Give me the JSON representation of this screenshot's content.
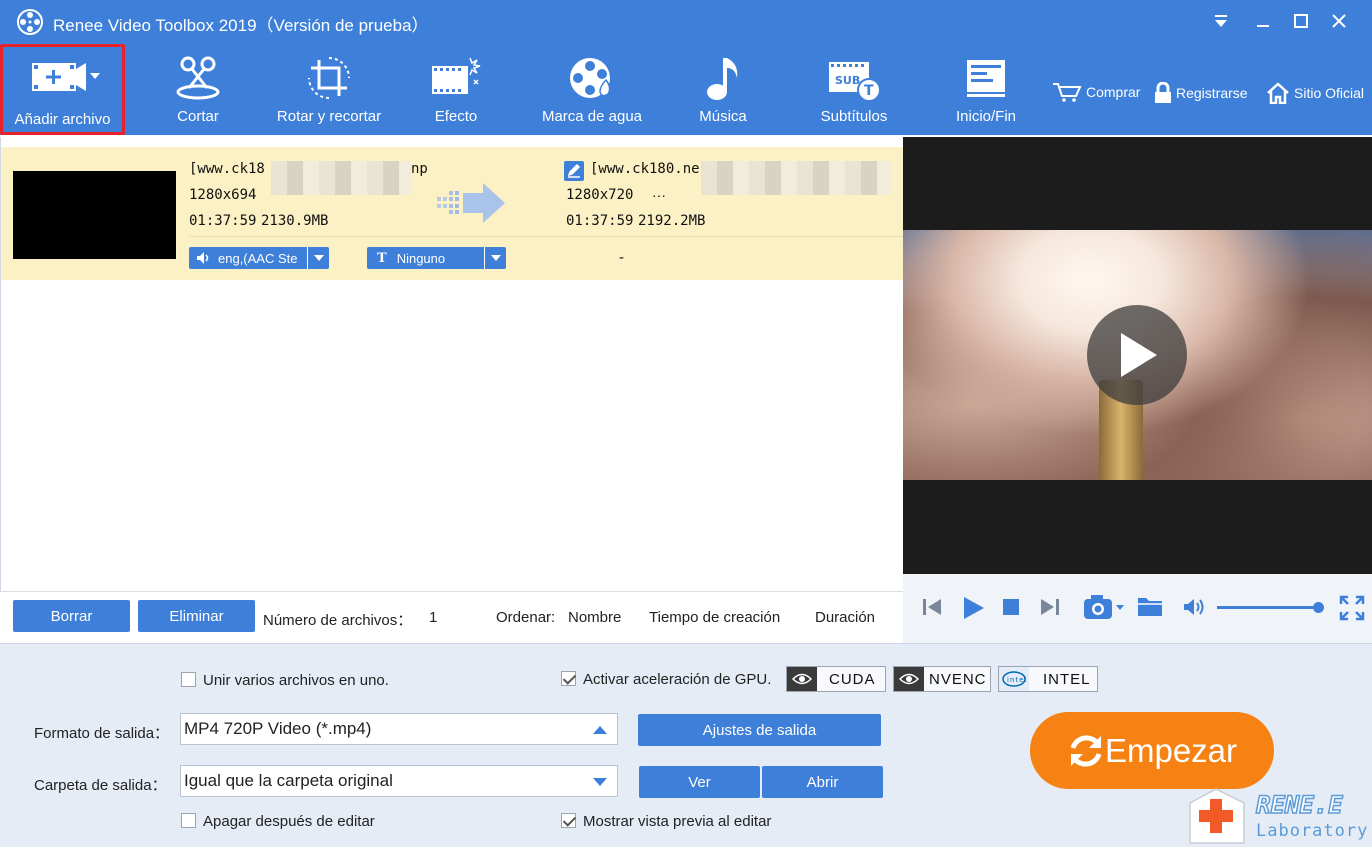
{
  "window": {
    "title": "Renee Video Toolbox 2019（Versión de prueba）"
  },
  "toolbar": {
    "items": [
      {
        "label": "Añadir archivo",
        "icon": "add-video-icon"
      },
      {
        "label": "Cortar",
        "icon": "scissors-icon"
      },
      {
        "label": "Rotar y recortar",
        "icon": "crop-rotate-icon"
      },
      {
        "label": "Efecto",
        "icon": "effect-icon"
      },
      {
        "label": "Marca de agua",
        "icon": "watermark-icon"
      },
      {
        "label": "Música",
        "icon": "music-note-icon"
      },
      {
        "label": "Subtítulos",
        "icon": "subtitle-icon"
      },
      {
        "label": "Inicio/Fin",
        "icon": "start-end-icon"
      }
    ],
    "links": {
      "buy": "Comprar",
      "register": "Registrarse",
      "site": "Sitio Oficial"
    }
  },
  "file": {
    "source_name_start": "[www.ck18",
    "source_name_end": "np",
    "source_resolution": "1280x694",
    "source_duration": "01:37:59",
    "source_size": "2130.9MB",
    "output_name_start": "[www.ck180.ne",
    "output_resolution": "1280x720",
    "output_more": "···",
    "output_duration": "01:37:59",
    "output_size": "2192.2MB",
    "audio_track": "eng,(AAC Ste",
    "subtitle": "Ninguno",
    "subtitle_output": "-"
  },
  "list_bar": {
    "delete_label": "Borrar",
    "remove_label": "Eliminar",
    "count_label": "Número de archivos：",
    "count_value": "1",
    "sort_label": "Ordenar:",
    "sort_name": "Nombre",
    "sort_created": "Tiempo de creación",
    "sort_duration": "Duración"
  },
  "player": {
    "volume": 1.0
  },
  "settings": {
    "merge_label": "Unir varios archivos en uno.",
    "merge_checked": false,
    "gpu_label": "Activar aceleración de GPU.",
    "gpu_checked": true,
    "gpu_options": [
      "CUDA",
      "NVENC",
      "INTEL"
    ],
    "format_label": "Formato de salida：",
    "format_value": "MP4 720P Video (*.mp4)",
    "output_settings_label": "Ajustes de salida",
    "folder_label": "Carpeta de salida：",
    "folder_value": "Igual que la carpeta original",
    "view_label": "Ver",
    "open_label": "Abrir",
    "shutdown_label": "Apagar después de editar",
    "shutdown_checked": false,
    "preview_label": "Mostrar vista previa al editar",
    "preview_checked": true,
    "start_label": "Empezar"
  },
  "watermark": {
    "brand": "RENE.E",
    "sub": "Laboratory"
  },
  "colors": {
    "primary": "#3d7fd9",
    "start": "#f58212",
    "row_highlight": "#fbf1c4",
    "highlight_border": "#e8222a"
  }
}
